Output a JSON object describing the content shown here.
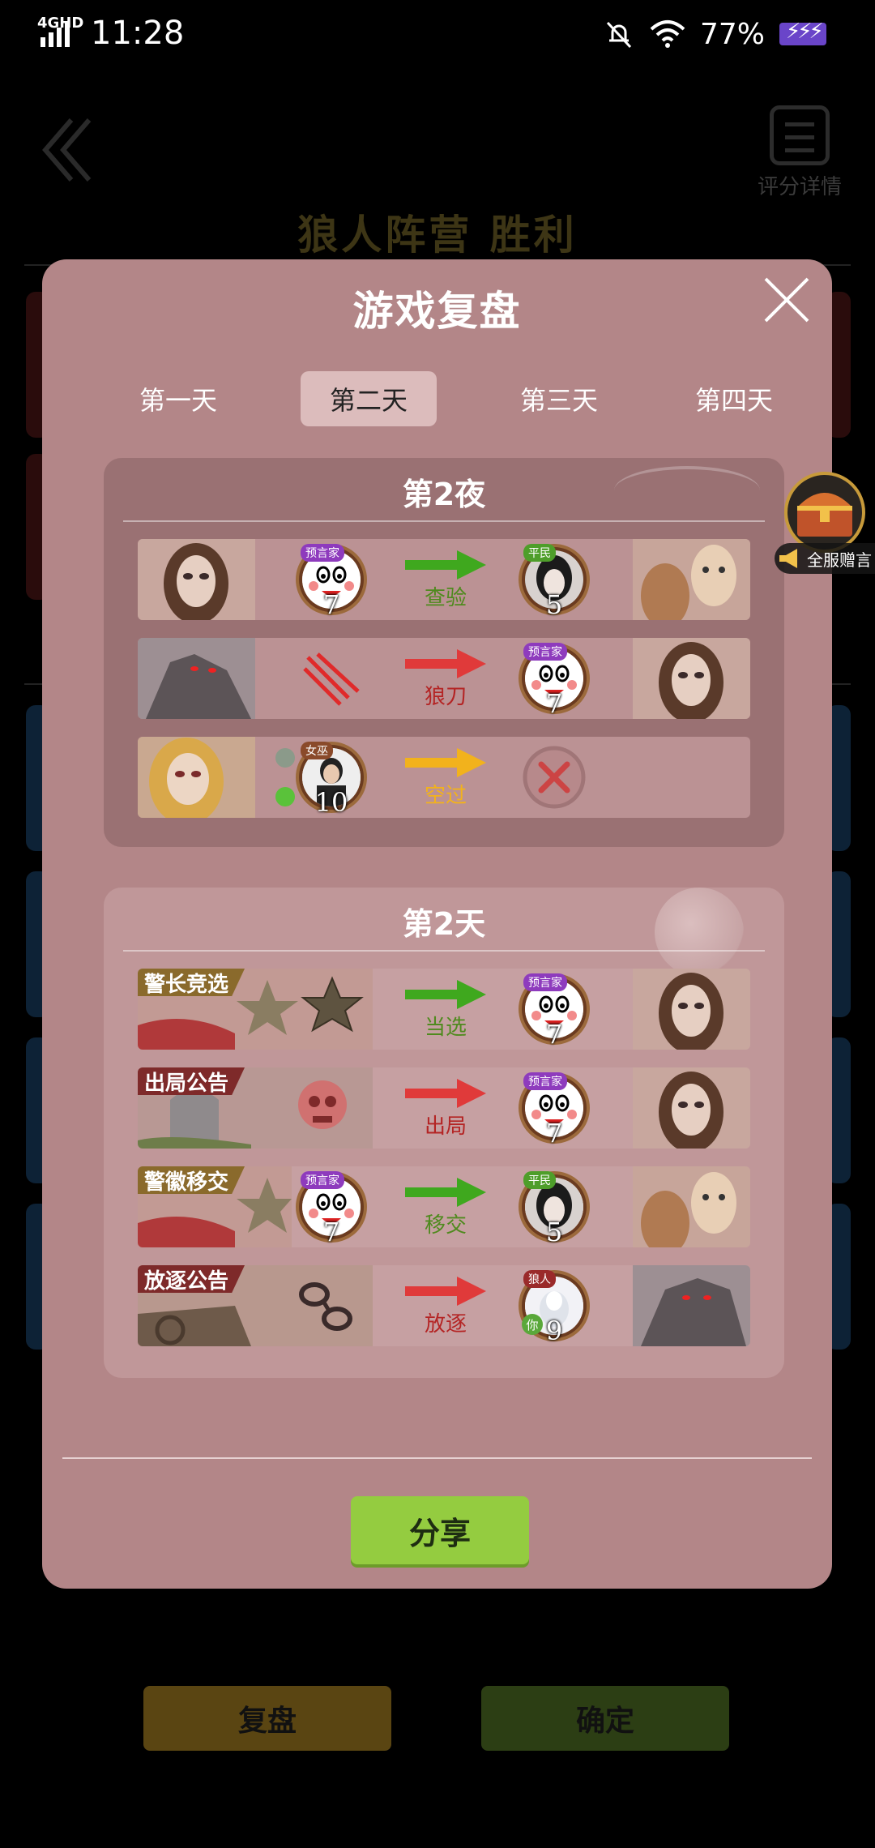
{
  "status_bar": {
    "network": "4GHD",
    "time": "11:28",
    "battery": "77%"
  },
  "background": {
    "title": "狼人阵营  胜利",
    "score_label": "评分详情",
    "replay_button": "复盘",
    "confirm_button": "确定"
  },
  "modal": {
    "title": "游戏复盘",
    "tabs": [
      "第一天",
      "第二天",
      "第三天",
      "第四天"
    ],
    "active_tab": "第二天",
    "night": {
      "title": "第2夜",
      "rows": [
        {
          "actor_role": "预言家",
          "actor_num": "7",
          "action": "查验",
          "target_role": "平民",
          "target_num": "5"
        },
        {
          "action": "狼刀",
          "target_role": "预言家",
          "target_num": "7"
        },
        {
          "actor_role": "女巫",
          "actor_num": "10",
          "action": "空过"
        }
      ]
    },
    "day": {
      "title": "第2天",
      "rows": [
        {
          "tag": "警长竞选",
          "action": "当选",
          "target_role": "预言家",
          "target_num": "7"
        },
        {
          "tag": "出局公告",
          "action": "出局",
          "target_role": "预言家",
          "target_num": "7"
        },
        {
          "tag": "警徽移交",
          "actor_role": "预言家",
          "actor_num": "7",
          "action": "移交",
          "target_role": "平民",
          "target_num": "5"
        },
        {
          "tag": "放逐公告",
          "action": "放逐",
          "target_role": "狼人",
          "target_num": "9",
          "you_badge": "你"
        }
      ]
    },
    "share_button": "分享"
  },
  "floating": {
    "label": "全服赠言"
  },
  "colors": {
    "modal_bg": "#b38688",
    "share_green": "#94cc40",
    "arrow_green": "#3fa81e",
    "arrow_red": "#e03a3a",
    "arrow_yellow": "#f2b21c"
  }
}
